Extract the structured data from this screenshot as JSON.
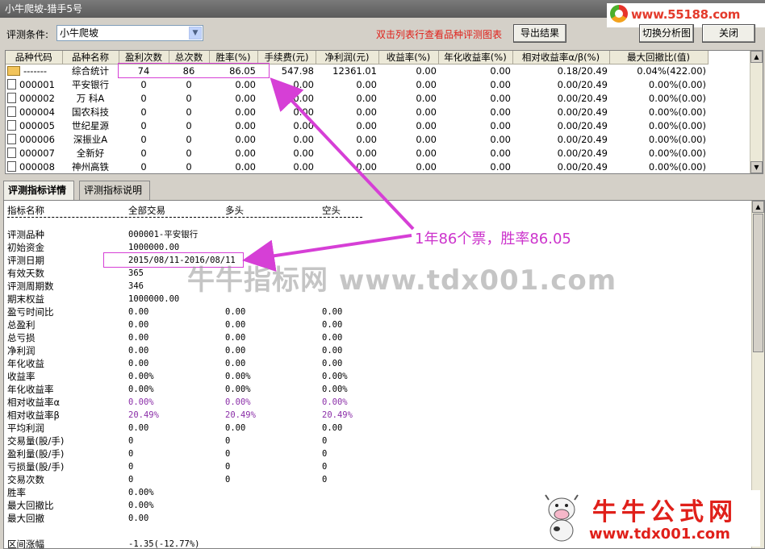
{
  "window": {
    "title": "小牛爬坡-猎手5号"
  },
  "branding": {
    "top_url": "www.55188.com",
    "bottom_cn": "牛牛公式网",
    "bottom_url": "www.tdx001.com",
    "watermark": "牛牛指标网 www.tdx001.com"
  },
  "toolbar": {
    "condition_label": "评测条件:",
    "condition_value": "小牛爬坡",
    "hint": "双击列表行查看品种评测图表",
    "export_label": "导出结果",
    "switch_label": "切换分析图",
    "close_label": "关闭"
  },
  "grid": {
    "columns": [
      "品种代码",
      "品种名称",
      "盈利次数",
      "总次数",
      "胜率(%)",
      "手续费(元)",
      "净利润(元)",
      "收益率(%)",
      "年化收益率(%)",
      "相对收益率α/β(%)",
      "最大回撤比(值)"
    ],
    "rows": [
      [
        "-------",
        "综合统计",
        "74",
        "86",
        "86.05",
        "547.98",
        "12361.01",
        "0.00",
        "0.00",
        "0.18/20.49",
        "0.04%(422.00)"
      ],
      [
        "000001",
        "平安银行",
        "0",
        "0",
        "0.00",
        "0.00",
        "0.00",
        "0.00",
        "0.00",
        "0.00/20.49",
        "0.00%(0.00)"
      ],
      [
        "000002",
        "万 科A",
        "0",
        "0",
        "0.00",
        "0.00",
        "0.00",
        "0.00",
        "0.00",
        "0.00/20.49",
        "0.00%(0.00)"
      ],
      [
        "000004",
        "国农科技",
        "0",
        "0",
        "0.00",
        "0.00",
        "0.00",
        "0.00",
        "0.00",
        "0.00/20.49",
        "0.00%(0.00)"
      ],
      [
        "000005",
        "世纪星源",
        "0",
        "0",
        "0.00",
        "0.00",
        "0.00",
        "0.00",
        "0.00",
        "0.00/20.49",
        "0.00%(0.00)"
      ],
      [
        "000006",
        "深振业A",
        "0",
        "0",
        "0.00",
        "0.00",
        "0.00",
        "0.00",
        "0.00",
        "0.00/20.49",
        "0.00%(0.00)"
      ],
      [
        "000007",
        "全新好",
        "0",
        "0",
        "0.00",
        "0.00",
        "0.00",
        "0.00",
        "0.00",
        "0.00/20.49",
        "0.00%(0.00)"
      ],
      [
        "000008",
        "神州高铁",
        "0",
        "0",
        "0.00",
        "0.00",
        "0.00",
        "0.00",
        "0.00",
        "0.00/20.49",
        "0.00%(0.00)"
      ]
    ]
  },
  "tabs": [
    "评测指标详情",
    "评测指标说明"
  ],
  "detail": {
    "headers": [
      "指标名称",
      "全部交易",
      "多头",
      "空头"
    ],
    "rows": [
      [
        "评测品种",
        "000001-平安银行",
        "",
        ""
      ],
      [
        "初始资金",
        "1000000.00",
        "",
        ""
      ],
      [
        "评测日期",
        "2015/08/11-2016/08/11",
        "",
        ""
      ],
      [
        "有效天数",
        "365",
        "",
        ""
      ],
      [
        "评测周期数",
        "346",
        "",
        ""
      ],
      [
        "期末权益",
        "1000000.00",
        "",
        ""
      ],
      [
        "盈亏时间比",
        "0.00",
        "0.00",
        "0.00"
      ],
      [
        "总盈利",
        "0.00",
        "0.00",
        "0.00"
      ],
      [
        "总亏损",
        "0.00",
        "0.00",
        "0.00"
      ],
      [
        "净利润",
        "0.00",
        "0.00",
        "0.00"
      ],
      [
        "年化收益",
        "0.00",
        "0.00",
        "0.00"
      ],
      [
        "收益率",
        "0.00%",
        "0.00%",
        "0.00%"
      ],
      [
        "年化收益率",
        "0.00%",
        "0.00%",
        "0.00%"
      ],
      [
        "相对收益率α",
        "0.00%",
        "0.00%",
        "0.00%"
      ],
      [
        "相对收益率β",
        "20.49%",
        "20.49%",
        "20.49%"
      ],
      [
        "平均利润",
        "0.00",
        "0.00",
        "0.00"
      ],
      [
        "交易量(股/手)",
        "0",
        "0",
        "0"
      ],
      [
        "盈利量(股/手)",
        "0",
        "0",
        "0"
      ],
      [
        "亏损量(股/手)",
        "0",
        "0",
        "0"
      ],
      [
        "交易次数",
        "0",
        "0",
        "0"
      ],
      [
        "胜率",
        "0.00%",
        "",
        ""
      ],
      [
        "最大回撤比",
        "0.00%",
        "",
        ""
      ],
      [
        "最大回撤",
        "0.00",
        "",
        ""
      ],
      [
        "",
        "",
        "",
        ""
      ],
      [
        "区间涨幅",
        "-1.35(-12.77%)",
        "",
        ""
      ]
    ]
  },
  "annotation": {
    "text": "1年86个票，胜率86.05",
    "color": "#cc33cc"
  },
  "colors": {
    "hint": "#e0201a",
    "highlight": "#d63fd6",
    "purple_values": "#8b2fa8"
  }
}
